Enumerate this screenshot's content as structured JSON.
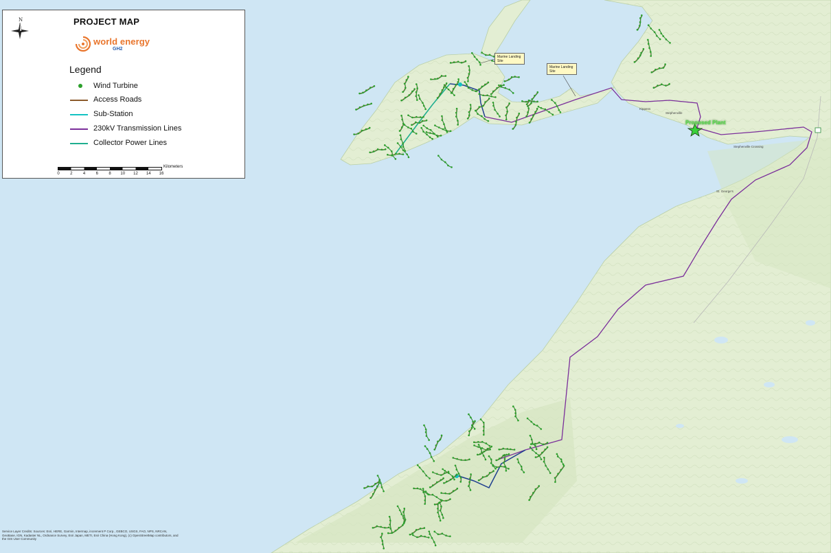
{
  "title": "PROJECT MAP",
  "compass": {
    "label": "N",
    "icon": "north-arrow-icon"
  },
  "logo": {
    "text": "world energy",
    "sub": "GH2",
    "icon": "swirl-logo-icon"
  },
  "legend": {
    "heading": "Legend",
    "items": [
      {
        "label": "Wind Turbine",
        "symbol": "dot",
        "color": "#2ca02c"
      },
      {
        "label": "Access Roads",
        "symbol": "line",
        "color": "#8b5a2b"
      },
      {
        "label": "Sub-Station",
        "symbol": "line",
        "color": "#12c2c2"
      },
      {
        "label": "230kV Transmission Lines",
        "symbol": "line",
        "color": "#7a2e9a"
      },
      {
        "label": "Collector Power Lines",
        "symbol": "line",
        "color": "#1fae8f"
      }
    ]
  },
  "scale": {
    "unit": "Kilometers",
    "ticks": [
      "0",
      "2",
      "4",
      "6",
      "8",
      "10",
      "12",
      "14",
      "16"
    ]
  },
  "callouts": [
    {
      "line1": "Marine Landing",
      "line2": "Site"
    },
    {
      "line1": "Marine Landing",
      "line2": "Site"
    }
  ],
  "plant_label": "Proposed Plant",
  "towns": [
    "Kippens",
    "Stephenville",
    "Stephenville Crossing",
    "St. George's"
  ],
  "credits": "Service Layer Credits: Sources: Esri, HERE, Garmin, Intermap, increment P Corp., GEBCO, USGS, FAO, NPS, NRCAN, GeoBase, IGN, Kadaster NL, Ordnance Survey, Esri Japan, METI, Esri China (Hong Kong), (c) OpenStreetMap contributors, and the GIS User Community",
  "colors": {
    "water": "#cfe6f4",
    "land": "#e3eed3",
    "transmission": "#7a2e9a",
    "road": "#8b5a2b",
    "turbine": "#2ca02c",
    "collector": "#1fae8f",
    "substation": "#12c2c2",
    "feeder": "#1f3f8f"
  }
}
